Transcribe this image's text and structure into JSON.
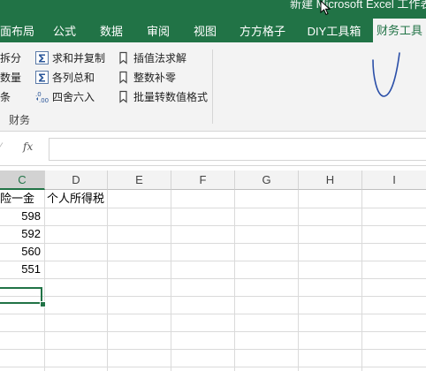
{
  "window": {
    "title_partial": "新建 Microsoft Excel 工作表"
  },
  "tabs": [
    {
      "label": "页面布局",
      "text": "面布局"
    },
    {
      "label": "公式",
      "text": "公式"
    },
    {
      "label": "数据",
      "text": "数据"
    },
    {
      "label": "审阅",
      "text": "审阅"
    },
    {
      "label": "视图",
      "text": "视图"
    },
    {
      "label": "方方格子",
      "text": "方方格子"
    },
    {
      "label": "DIY工具箱",
      "text": "DIY工具箱"
    },
    {
      "label": "财务工具",
      "text": "财务工具"
    }
  ],
  "ribbon": {
    "col1": [
      "拆分",
      "数量",
      "条"
    ],
    "col2": [
      "求和并复制",
      "各列总和",
      "四舍六入"
    ],
    "col3": [
      "插值法求解",
      "整数补零",
      "批量转数值格式"
    ],
    "group_label": "财务"
  },
  "formula_bar": {
    "fx": "fx",
    "value": ""
  },
  "columns": [
    "C",
    "D",
    "E",
    "F",
    "G",
    "H",
    "I"
  ],
  "cells": {
    "c_header": "险一金",
    "d_header": "个人所得税",
    "c_values": [
      "598",
      "592",
      "560",
      "551"
    ]
  },
  "colors": {
    "accent": "#217346",
    "ribbon_bg": "#f3f3f3"
  }
}
